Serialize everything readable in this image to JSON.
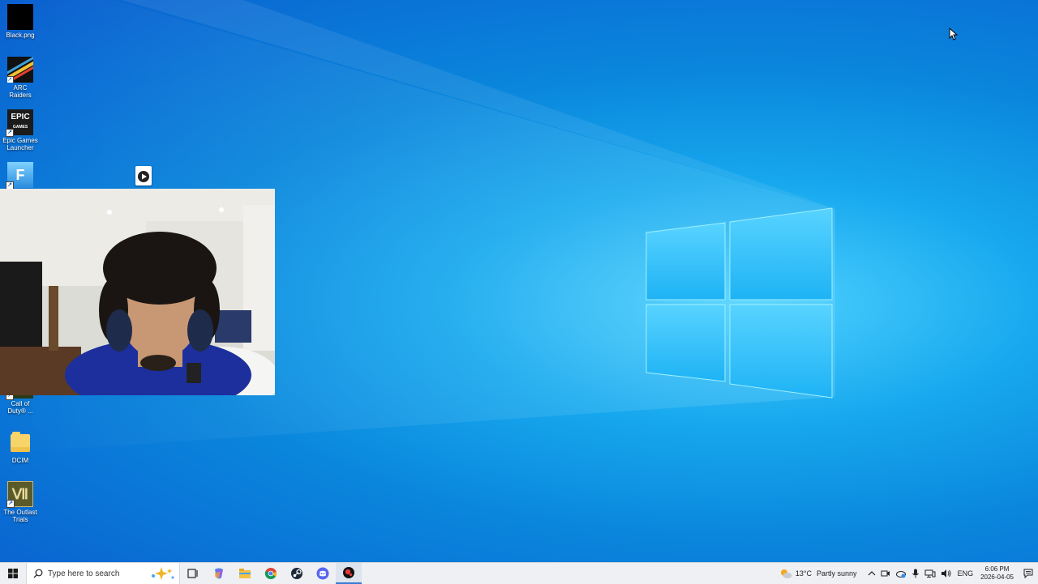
{
  "desktop": {
    "icons": [
      {
        "label": "Black.png",
        "icon": "black-image-icon"
      },
      {
        "label": "ARC Raiders",
        "icon": "arc-raiders-icon"
      },
      {
        "label": "Epic Games Launcher",
        "icon": "epic-games-icon"
      },
      {
        "label": "",
        "icon": "fortnite-icon"
      },
      {
        "label": "Call of Duty® ...",
        "icon": "call-of-duty-icon"
      },
      {
        "label": "DCIM",
        "icon": "folder-icon"
      },
      {
        "label": "The Outlast Trials",
        "icon": "outlast-trials-icon"
      }
    ],
    "webcam": {
      "icon": "webcam-overlay"
    },
    "media_badge": {
      "icon": "play-icon"
    },
    "cursor": {
      "icon": "mouse-pointer-icon"
    }
  },
  "taskbar": {
    "start": {
      "icon": "windows-start-icon"
    },
    "search": {
      "placeholder": "Type here to search",
      "icon": "search-icon",
      "highlight_icon": "sparkle-icon"
    },
    "apps": [
      {
        "icon": "task-view-icon"
      },
      {
        "icon": "copilot-icon"
      },
      {
        "icon": "file-explorer-icon"
      },
      {
        "icon": "chrome-icon"
      },
      {
        "icon": "steam-icon"
      },
      {
        "icon": "discord-icon"
      },
      {
        "icon": "recording-app-icon"
      }
    ],
    "weather": {
      "temp": "13°C",
      "condition": "Partly sunny",
      "icon": "partly-sunny-icon"
    },
    "tray": {
      "language": "ENG",
      "time": "6:06 PM",
      "date": "2026-04-05",
      "icons": [
        "chevron-up-icon",
        "meet-now-icon",
        "onedrive-icon",
        "microphone-icon",
        "network-icon",
        "volume-icon"
      ],
      "notifications_icon": "notifications-icon"
    }
  },
  "colors": {
    "desktop_accent": "#1aa7ec",
    "taskbar_bg": "#eef0f3"
  }
}
